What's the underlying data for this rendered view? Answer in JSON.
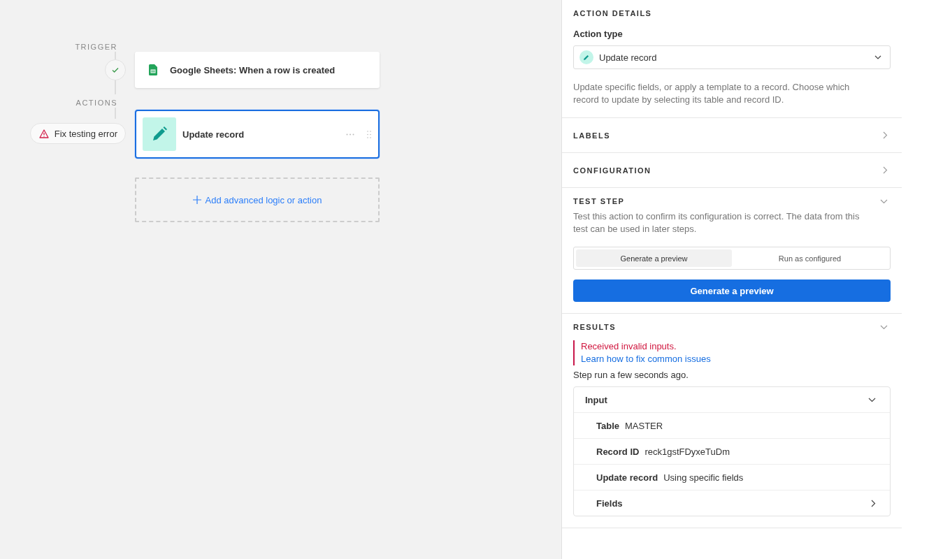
{
  "canvas": {
    "trigger_label": "TRIGGER",
    "trigger": {
      "title": "Google Sheets: When a row is created",
      "done": true
    },
    "actions_label": "ACTIONS",
    "error_badge": "Fix testing error",
    "action": {
      "title": "Update record",
      "selected": true
    },
    "add_button": "Add advanced logic or action"
  },
  "panel": {
    "action_details": {
      "heading": "ACTION DETAILS",
      "field_label": "Action type",
      "action_type": "Update record",
      "description": "Update specific fields, or apply a template to a record. Choose which record to update by selecting its table and record ID."
    },
    "labels": {
      "heading": "LABELS",
      "expanded": false
    },
    "configuration": {
      "heading": "CONFIGURATION",
      "expanded": false
    },
    "test_step": {
      "heading": "TEST STEP",
      "expanded": true,
      "description": "Test this action to confirm its configuration is correct. The data from this test can be used in later steps.",
      "modes": [
        {
          "label": "Generate a preview",
          "selected": true
        },
        {
          "label": "Run as configured",
          "selected": false
        }
      ],
      "button": "Generate a preview"
    },
    "results": {
      "heading": "RESULTS",
      "expanded": true,
      "error": "Received invalid inputs.",
      "help_link": "Learn how to fix common issues",
      "run_note": "Step run a few seconds ago.",
      "input": {
        "title": "Input",
        "expanded": true,
        "rows": [
          {
            "kind": "value",
            "label": "Table",
            "value": "MASTER"
          },
          {
            "kind": "value",
            "label": "Record ID",
            "value": "reck1gstFDyxeTuDm"
          },
          {
            "kind": "value",
            "label": "Update record",
            "value": "Using specific fields"
          },
          {
            "kind": "group",
            "label": "Fields",
            "expanded": false
          }
        ]
      }
    }
  }
}
